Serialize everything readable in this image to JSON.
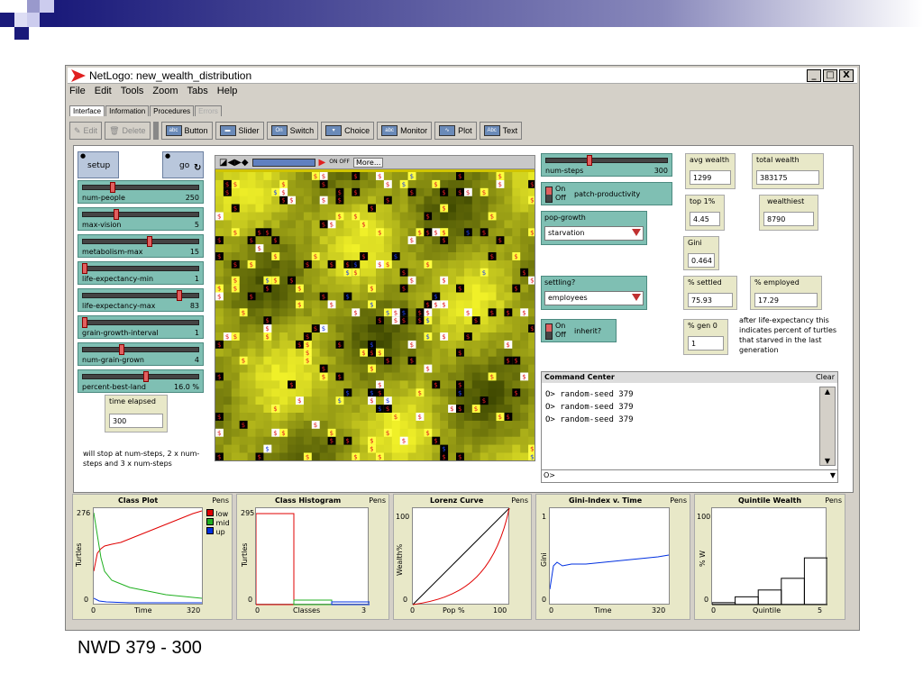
{
  "window": {
    "title": "NetLogo: new_wealth_distribution"
  },
  "menu": [
    "File",
    "Edit",
    "Tools",
    "Zoom",
    "Tabs",
    "Help"
  ],
  "tabs": [
    {
      "label": "Interface",
      "active": true
    },
    {
      "label": "Information"
    },
    {
      "label": "Procedures"
    },
    {
      "label": "Errors",
      "disabled": true
    }
  ],
  "toolbar": {
    "edit": "Edit",
    "delete": "Delete",
    "button": "Button",
    "slider": "Slider",
    "switch": "Switch",
    "choice": "Choice",
    "monitor": "Monitor",
    "plot": "Plot",
    "text": "Text"
  },
  "buttons": {
    "setup": "setup",
    "go": "go"
  },
  "sliders": [
    {
      "label": "num-people",
      "value": "250",
      "pos": 0.25
    },
    {
      "label": "max-vision",
      "value": "5",
      "pos": 0.28
    },
    {
      "label": "metabolism-max",
      "value": "15",
      "pos": 0.58
    },
    {
      "label": "life-expectancy-min",
      "value": "1",
      "pos": 0.0
    },
    {
      "label": "life-expectancy-max",
      "value": "83",
      "pos": 0.85
    },
    {
      "label": "grain-growth-interval",
      "value": "1",
      "pos": 0.0
    },
    {
      "label": "num-grain-grown",
      "value": "4",
      "pos": 0.33
    },
    {
      "label": "percent-best-land",
      "value": "16.0 %",
      "pos": 0.55
    }
  ],
  "time_elapsed": {
    "label": "time elapsed",
    "value": "300"
  },
  "stop_note": "will stop at num-steps, 2 x num-steps and 3 x num-steps",
  "world_bar": {
    "more": "More...",
    "onoff": "ON OFF"
  },
  "num_steps": {
    "label": "num-steps",
    "value": "300",
    "pos": 0.35
  },
  "switches": {
    "patch_productivity": "patch-productivity",
    "inherit": "inherit?",
    "on": "On",
    "off": "Off"
  },
  "choosers": {
    "pop_growth": {
      "label": "pop-growth",
      "value": "starvation"
    },
    "settling": {
      "label": "settling?",
      "value": "employees"
    }
  },
  "monitors": {
    "avg_wealth": {
      "label": "avg wealth",
      "value": "1299"
    },
    "total_wealth": {
      "label": "total wealth",
      "value": "383175"
    },
    "top1": {
      "label": "top 1%",
      "value": "4.45"
    },
    "wealthiest": {
      "label": "wealthiest",
      "value": "8790"
    },
    "gini": {
      "label": "Gini",
      "value": "0.464"
    },
    "settled": {
      "label": "% settled",
      "value": "75.93"
    },
    "employed": {
      "label": "% employed",
      "value": "17.29"
    },
    "gen0": {
      "label": "% gen 0",
      "value": "1"
    }
  },
  "gen0_note": "after life-expectancy this indicates percent of turtles that starved in the last generation",
  "command_center": {
    "title": "Command Center",
    "clear": "Clear",
    "lines": [
      "O> random-seed 379",
      "O> random-seed 379",
      "O> random-seed 379"
    ],
    "prompt": "O>"
  },
  "plots": {
    "class_plot": {
      "title": "Class Plot",
      "pens": "Pens",
      "ymax": "276",
      "ymin": "0",
      "xmin": "0",
      "xmax": "320",
      "xlabel": "Time",
      "ylabel": "Turtles",
      "legend": [
        {
          "name": "low",
          "color": "#e00000"
        },
        {
          "name": "mid",
          "color": "#20b020"
        },
        {
          "name": "up",
          "color": "#0030e0"
        }
      ]
    },
    "class_hist": {
      "title": "Class Histogram",
      "pens": "Pens",
      "ymax": "295",
      "ymin": "0",
      "xmin": "0",
      "xmax": "3",
      "xlabel": "Classes",
      "ylabel": "Turtles"
    },
    "lorenz": {
      "title": "Lorenz Curve",
      "pens": "Pens",
      "ymax": "100",
      "ymin": "0",
      "xmin": "0",
      "xmax": "100",
      "xlabel": "Pop %",
      "ylabel": "Wealth%"
    },
    "gini_time": {
      "title": "Gini-Index v. Time",
      "pens": "Pens",
      "ymax": "1",
      "ymin": "0",
      "xmin": "0",
      "xmax": "320",
      "xlabel": "Time",
      "ylabel": "Gini"
    },
    "quintile": {
      "title": "Quintile Wealth",
      "pens": "Pens",
      "ymax": "100",
      "ymin": "0",
      "xmin": "0",
      "xmax": "5",
      "xlabel": "Quintile",
      "ylabel": "% W",
      "values": [
        2,
        8,
        15,
        27,
        48
      ]
    }
  },
  "footer": "NWD 379 - 300"
}
